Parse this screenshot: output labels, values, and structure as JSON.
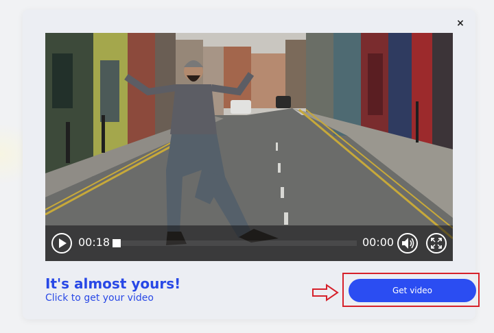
{
  "modal": {
    "close_label": "×"
  },
  "player": {
    "current_time": "00:18",
    "duration": "00:00",
    "progress": 0.0,
    "icons": {
      "play": "play-icon",
      "volume": "volume-icon",
      "fullscreen": "fullscreen-icon"
    }
  },
  "promo": {
    "headline": "It's almost yours!",
    "subline": "Click to get your video",
    "button_label": "Get video"
  },
  "colors": {
    "accent": "#2b4df2",
    "headline": "#2848e6",
    "highlight": "#d6202a"
  }
}
